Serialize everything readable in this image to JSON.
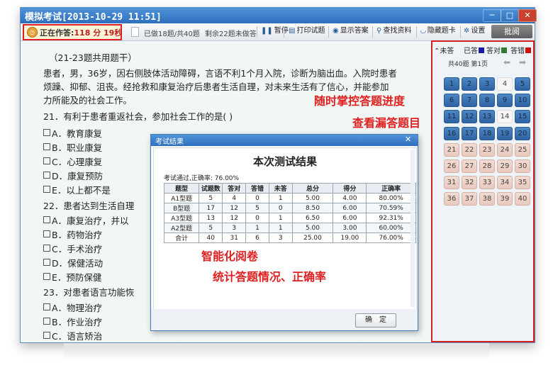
{
  "window": {
    "title": "模拟考试[2013-10-29 11:51]",
    "min_icon": "minimize-icon",
    "max_icon": "maximize-icon",
    "close_icon": "close-icon"
  },
  "toolbar": {
    "timer_label": "正在作答:",
    "timer_value": "118 分 19秒",
    "done_info": "已做18题/共40题",
    "remain_info": "剩余22题未做答",
    "pause": "暂停",
    "print": "打印试题",
    "show_answer": "显示答案",
    "lookup": "查找资料",
    "hide_card": "隐藏题卡",
    "settings": "设置",
    "grade": "批阅"
  },
  "questions": {
    "group_header": "（21-23题共用题干）",
    "stem_lines": [
      "患者，男，36岁，因右侧肢体活动障碍，言语不利1个月入院，诊断为脑出血。入院时患者",
      "烦躁、抑郁、沮丧。经抢救和康复治疗后患者生活自理，对未来生活有了信心，并能参加",
      "力所能及的社会工作。"
    ],
    "q21": "21．有利于患者重返社会，参加社会工作的是(      )",
    "q21_options": [
      "A．教育康复",
      "B．职业康复",
      "C．心理康复",
      "D．康复预防",
      "E．以上都不是"
    ],
    "q22": "22．患者达到生活自理",
    "q22_options": [
      "A．康复治疗，并以",
      "B．药物治疗",
      "C．手术治疗",
      "D．保健活动",
      "E．预防保健"
    ],
    "q23": "23．对患者语言功能恢",
    "q23_options": [
      "A．物理治疗",
      "B．作业治疗",
      "C．语言矫治"
    ]
  },
  "answer_card": {
    "legend": {
      "unanswered": "未答",
      "answered": "已答",
      "correct": "答对",
      "wrong": "答错"
    },
    "legend_colors": {
      "answered": "#1a1aa8",
      "correct": "#2e7d2e",
      "wrong": "#d01010"
    },
    "page_info": "共40题  第1页",
    "prev_icon": "arrow-left-icon",
    "next_icon": "arrow-right-icon",
    "numbers": [
      "1",
      "2",
      "3",
      "4",
      "5",
      "6",
      "7",
      "8",
      "9",
      "10",
      "11",
      "12",
      "13",
      "14",
      "15",
      "16",
      "17",
      "18",
      "19",
      "20",
      "21",
      "22",
      "23",
      "24",
      "25",
      "26",
      "27",
      "28",
      "29",
      "30",
      "31",
      "32",
      "33",
      "34",
      "35",
      "36",
      "37",
      "38",
      "39",
      "40"
    ],
    "status": [
      "d",
      "d",
      "d",
      "c",
      "d",
      "d",
      "d",
      "d",
      "d",
      "d",
      "d",
      "d",
      "d",
      "c",
      "d",
      "d",
      "d",
      "d",
      "d",
      "d",
      "u",
      "u",
      "u",
      "u",
      "u",
      "u",
      "u",
      "u",
      "u",
      "u",
      "u",
      "u",
      "u",
      "u",
      "u",
      "u",
      "u",
      "u",
      "u",
      "u"
    ]
  },
  "annotations": {
    "progress": "随时掌控答题进度",
    "missing": "查看漏答题目",
    "grading": "智能化阅卷",
    "stats": "统计答题情况、正确率"
  },
  "dialog": {
    "title": "考试结果",
    "heading": "本次测试结果",
    "summary": "考试通过,正确率: 76.00%",
    "columns": [
      "题型",
      "试题数",
      "答对",
      "答错",
      "未答",
      "总分",
      "得分",
      "正确率"
    ],
    "rows": [
      [
        "A1型题",
        "5",
        "4",
        "0",
        "1",
        "5.00",
        "4.00",
        "80.00%"
      ],
      [
        "B型题",
        "17",
        "12",
        "5",
        "0",
        "8.50",
        "6.00",
        "70.59%"
      ],
      [
        "A3型题",
        "13",
        "12",
        "0",
        "1",
        "6.50",
        "6.00",
        "92.31%"
      ],
      [
        "A2型题",
        "5",
        "3",
        "1",
        "1",
        "5.00",
        "3.00",
        "60.00%"
      ],
      [
        "合计",
        "40",
        "31",
        "6",
        "3",
        "25.00",
        "19.00",
        "76.00%"
      ]
    ],
    "ok": "确　定"
  }
}
